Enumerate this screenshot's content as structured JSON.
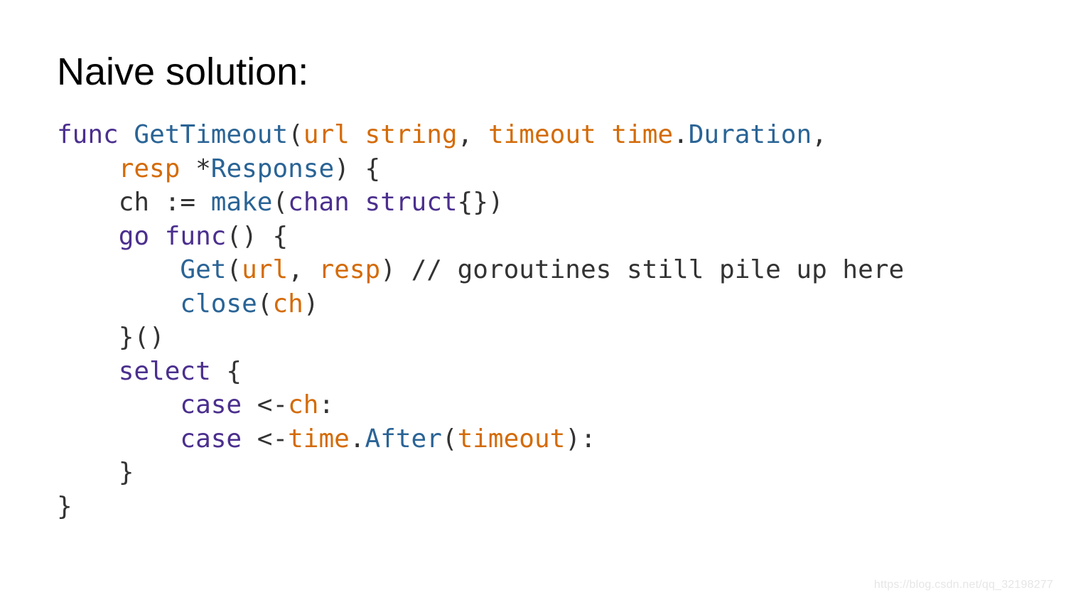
{
  "title": "Naive solution:",
  "code": {
    "l1a": "func",
    "l1b": "GetTimeout",
    "l1c": "(",
    "l1d": "url string",
    "l1e": ",",
    "l1f": "timeout time",
    "l1g": ".",
    "l1h": "Duration",
    "l1i": ",",
    "l2a": "resp ",
    "l2b": "*",
    "l2c": "Response",
    "l2d": ") {",
    "l3a": "    ch ",
    "l3b": ":=",
    "l3c": " make",
    "l3d": "(",
    "l3e": "chan",
    "l3f": " struct",
    "l3g": "{})",
    "l4a": "    go func",
    "l4b": "() {",
    "l5a": "        Get",
    "l5b": "(",
    "l5c": "url",
    "l5d": ",",
    "l5e": " resp",
    "l5f": ")",
    "l5g": " // goroutines still pile up here",
    "l6a": "        close",
    "l6b": "(",
    "l6c": "ch",
    "l6d": ")",
    "l7a": "    }()",
    "l8a": "    select ",
    "l8b": "{",
    "l9a": "        case ",
    "l9b": "<-",
    "l9c": "ch",
    "l9d": ":",
    "l10a": "        case ",
    "l10b": "<-",
    "l10c": "time",
    "l10d": ".",
    "l10e": "After",
    "l10f": "(",
    "l10g": "timeout",
    "l10h": "):",
    "l11a": "    }",
    "l12a": "}"
  },
  "watermark": "https://blog.csdn.net/qq_32198277"
}
